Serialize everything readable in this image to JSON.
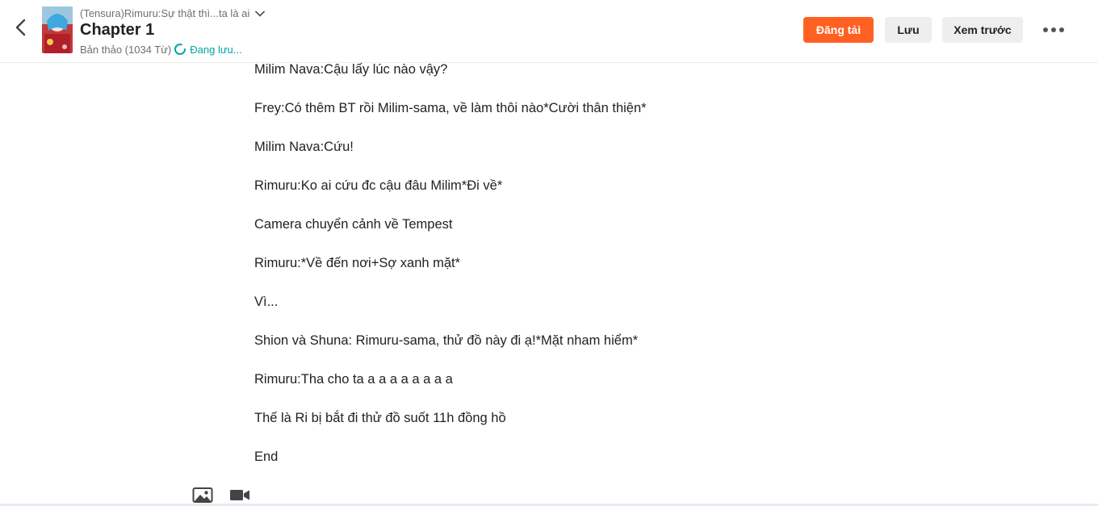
{
  "header": {
    "story_title": "(Tensura)Rimuru:Sự thật thì...ta là ai",
    "chapter_title": "Chapter 1",
    "draft_status": "Bản thảo (1034 Từ)",
    "saving_status": "Đang lưu...",
    "publish_label": "Đăng tải",
    "save_label": "Lưu",
    "preview_label": "Xem trước"
  },
  "content": {
    "paragraphs": [
      "Milim Nava:Cậu lấy lúc nào vậy?",
      "Frey:Có thêm BT rồi Milim-sama, về làm thôi nào*Cười thân thiện*",
      "Milim Nava:Cứu!",
      "Rimuru:Ko ai cứu đc cậu đâu Milim*Đi về*",
      "Camera chuyển cảnh về Tempest",
      "Rimuru:*Về đến nơi+Sợ xanh mặt*",
      "Vì...",
      "Shion và Shuna: Rimuru-sama, thử đồ này đi ạ!*Mặt nham hiểm*",
      "Rimuru:Tha cho ta a a a a a a a a",
      "Thế là Ri bị bắt đi thử đồ suốt 11h đồng hồ",
      "End"
    ]
  },
  "icons": {
    "back": "chevron-left-icon",
    "story_menu": "chevron-down-icon",
    "saving": "spinner-icon",
    "more": "more-options-icon",
    "image": "image-icon",
    "video": "video-icon"
  },
  "colors": {
    "publish": "#ff6122",
    "secondary_button": "#eeeeee",
    "saving_text": "#00a6a6"
  }
}
